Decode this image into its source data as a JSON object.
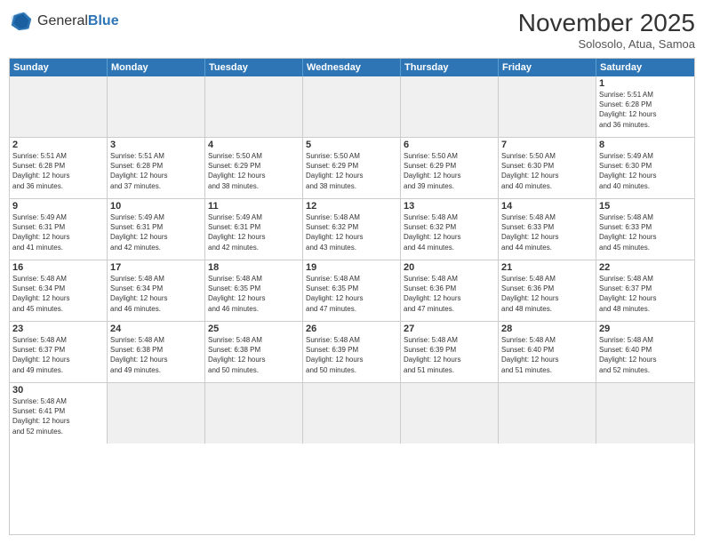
{
  "header": {
    "logo_general": "General",
    "logo_blue": "Blue",
    "month_year": "November 2025",
    "location": "Solosolo, Atua, Samoa"
  },
  "weekdays": [
    "Sunday",
    "Monday",
    "Tuesday",
    "Wednesday",
    "Thursday",
    "Friday",
    "Saturday"
  ],
  "rows": [
    [
      {
        "day": "",
        "info": ""
      },
      {
        "day": "",
        "info": ""
      },
      {
        "day": "",
        "info": ""
      },
      {
        "day": "",
        "info": ""
      },
      {
        "day": "",
        "info": ""
      },
      {
        "day": "",
        "info": ""
      },
      {
        "day": "1",
        "info": "Sunrise: 5:51 AM\nSunset: 6:28 PM\nDaylight: 12 hours\nand 36 minutes."
      }
    ],
    [
      {
        "day": "2",
        "info": "Sunrise: 5:51 AM\nSunset: 6:28 PM\nDaylight: 12 hours\nand 36 minutes."
      },
      {
        "day": "3",
        "info": "Sunrise: 5:51 AM\nSunset: 6:28 PM\nDaylight: 12 hours\nand 37 minutes."
      },
      {
        "day": "4",
        "info": "Sunrise: 5:50 AM\nSunset: 6:29 PM\nDaylight: 12 hours\nand 38 minutes."
      },
      {
        "day": "5",
        "info": "Sunrise: 5:50 AM\nSunset: 6:29 PM\nDaylight: 12 hours\nand 38 minutes."
      },
      {
        "day": "6",
        "info": "Sunrise: 5:50 AM\nSunset: 6:29 PM\nDaylight: 12 hours\nand 39 minutes."
      },
      {
        "day": "7",
        "info": "Sunrise: 5:50 AM\nSunset: 6:30 PM\nDaylight: 12 hours\nand 40 minutes."
      },
      {
        "day": "8",
        "info": "Sunrise: 5:49 AM\nSunset: 6:30 PM\nDaylight: 12 hours\nand 40 minutes."
      }
    ],
    [
      {
        "day": "9",
        "info": "Sunrise: 5:49 AM\nSunset: 6:31 PM\nDaylight: 12 hours\nand 41 minutes."
      },
      {
        "day": "10",
        "info": "Sunrise: 5:49 AM\nSunset: 6:31 PM\nDaylight: 12 hours\nand 42 minutes."
      },
      {
        "day": "11",
        "info": "Sunrise: 5:49 AM\nSunset: 6:31 PM\nDaylight: 12 hours\nand 42 minutes."
      },
      {
        "day": "12",
        "info": "Sunrise: 5:48 AM\nSunset: 6:32 PM\nDaylight: 12 hours\nand 43 minutes."
      },
      {
        "day": "13",
        "info": "Sunrise: 5:48 AM\nSunset: 6:32 PM\nDaylight: 12 hours\nand 44 minutes."
      },
      {
        "day": "14",
        "info": "Sunrise: 5:48 AM\nSunset: 6:33 PM\nDaylight: 12 hours\nand 44 minutes."
      },
      {
        "day": "15",
        "info": "Sunrise: 5:48 AM\nSunset: 6:33 PM\nDaylight: 12 hours\nand 45 minutes."
      }
    ],
    [
      {
        "day": "16",
        "info": "Sunrise: 5:48 AM\nSunset: 6:34 PM\nDaylight: 12 hours\nand 45 minutes."
      },
      {
        "day": "17",
        "info": "Sunrise: 5:48 AM\nSunset: 6:34 PM\nDaylight: 12 hours\nand 46 minutes."
      },
      {
        "day": "18",
        "info": "Sunrise: 5:48 AM\nSunset: 6:35 PM\nDaylight: 12 hours\nand 46 minutes."
      },
      {
        "day": "19",
        "info": "Sunrise: 5:48 AM\nSunset: 6:35 PM\nDaylight: 12 hours\nand 47 minutes."
      },
      {
        "day": "20",
        "info": "Sunrise: 5:48 AM\nSunset: 6:36 PM\nDaylight: 12 hours\nand 47 minutes."
      },
      {
        "day": "21",
        "info": "Sunrise: 5:48 AM\nSunset: 6:36 PM\nDaylight: 12 hours\nand 48 minutes."
      },
      {
        "day": "22",
        "info": "Sunrise: 5:48 AM\nSunset: 6:37 PM\nDaylight: 12 hours\nand 48 minutes."
      }
    ],
    [
      {
        "day": "23",
        "info": "Sunrise: 5:48 AM\nSunset: 6:37 PM\nDaylight: 12 hours\nand 49 minutes."
      },
      {
        "day": "24",
        "info": "Sunrise: 5:48 AM\nSunset: 6:38 PM\nDaylight: 12 hours\nand 49 minutes."
      },
      {
        "day": "25",
        "info": "Sunrise: 5:48 AM\nSunset: 6:38 PM\nDaylight: 12 hours\nand 50 minutes."
      },
      {
        "day": "26",
        "info": "Sunrise: 5:48 AM\nSunset: 6:39 PM\nDaylight: 12 hours\nand 50 minutes."
      },
      {
        "day": "27",
        "info": "Sunrise: 5:48 AM\nSunset: 6:39 PM\nDaylight: 12 hours\nand 51 minutes."
      },
      {
        "day": "28",
        "info": "Sunrise: 5:48 AM\nSunset: 6:40 PM\nDaylight: 12 hours\nand 51 minutes."
      },
      {
        "day": "29",
        "info": "Sunrise: 5:48 AM\nSunset: 6:40 PM\nDaylight: 12 hours\nand 52 minutes."
      }
    ],
    [
      {
        "day": "30",
        "info": "Sunrise: 5:48 AM\nSunset: 6:41 PM\nDaylight: 12 hours\nand 52 minutes."
      },
      {
        "day": "",
        "info": ""
      },
      {
        "day": "",
        "info": ""
      },
      {
        "day": "",
        "info": ""
      },
      {
        "day": "",
        "info": ""
      },
      {
        "day": "",
        "info": ""
      },
      {
        "day": "",
        "info": ""
      }
    ]
  ]
}
